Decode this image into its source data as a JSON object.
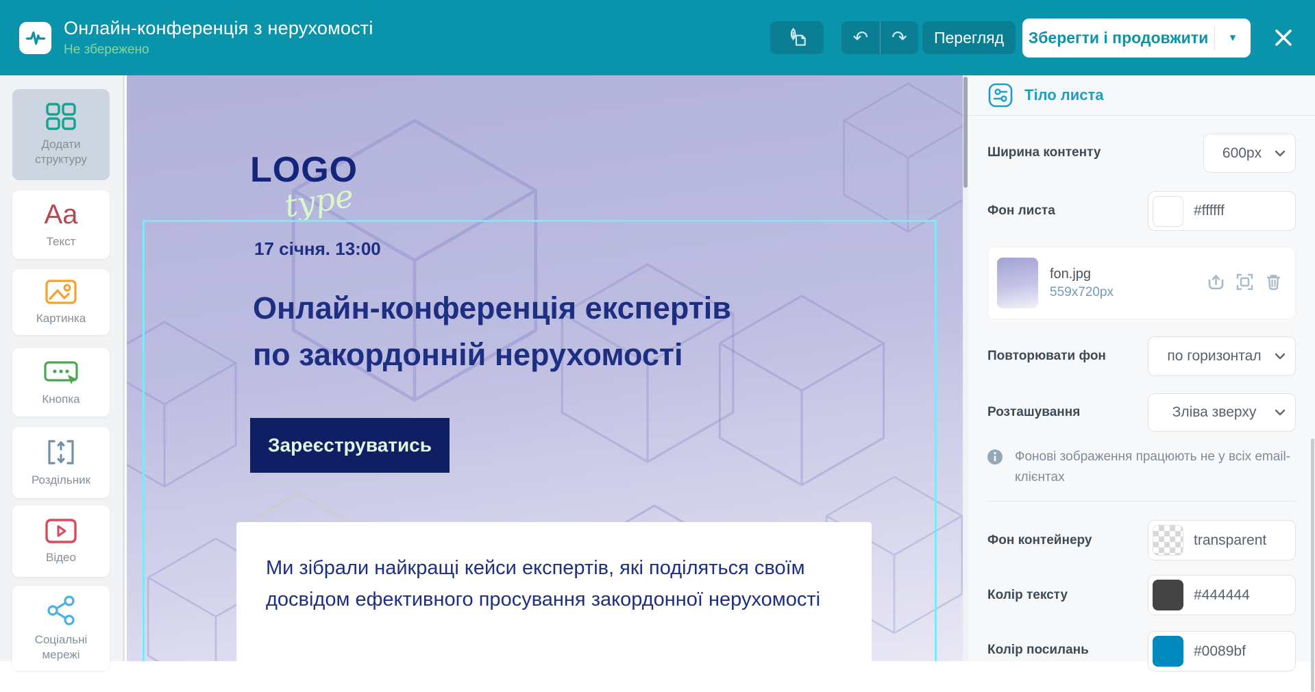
{
  "header": {
    "title": "Онлайн-конференція з нерухомості",
    "status": "Не збережено",
    "undo_glyph": "↶",
    "redo_glyph": "↷",
    "preview_label": "Перегляд",
    "save_label": "Зберегти і продовжити",
    "save_caret": "▾"
  },
  "sidebar": {
    "items": [
      {
        "label": "Додати структуру",
        "icon": "add-structure-icon",
        "selected": true
      },
      {
        "label": "Текст",
        "icon": "text-icon",
        "glyph": "Aa"
      },
      {
        "label": "Картинка",
        "icon": "image-icon"
      },
      {
        "label": "Кнопка",
        "icon": "button-icon"
      },
      {
        "label": "Роздільник",
        "icon": "divider-icon"
      },
      {
        "label": "Відео",
        "icon": "video-icon"
      },
      {
        "label": "Соціальні мережі",
        "icon": "social-icon"
      }
    ]
  },
  "canvas": {
    "logo_main": "LOGO",
    "logo_script": "type",
    "date": "17 січня. 13:00",
    "heading_line1": "Онлайн-конференція експертів",
    "heading_line2": "по закордонній нерухомості",
    "register_button": "Зареєструватись",
    "body_text": "Ми зібрали найкращі кейси експертів, які поділяться своїм досвідом ефективного просування закордонної нерухомості"
  },
  "panel": {
    "title": "Тіло листа",
    "content_width": {
      "label": "Ширина контенту",
      "value": "600px"
    },
    "letter_bg": {
      "label": "Фон листа",
      "value": "#ffffff"
    },
    "bg_file": {
      "name": "fon.jpg",
      "dimensions": "559x720px"
    },
    "repeat_bg": {
      "label": "Повторювати фон",
      "value": "по горизонтал"
    },
    "position": {
      "label": "Розташування",
      "value": "Зліва зверху"
    },
    "info_text": "Фонові зображення працюють не у всіх email-клієнтах",
    "container_bg": {
      "label": "Фон контейнеру",
      "value": "transparent"
    },
    "text_color": {
      "label": "Колір тексту",
      "value": "#444444"
    },
    "link_color": {
      "label": "Колір посилань",
      "value": "#0089bf"
    }
  },
  "colors": {
    "header_teal": "#0a94ab",
    "selection_cyan": "#7de8f8",
    "email_navy": "#1d2f82",
    "email_button_bg": "#101f63",
    "text_swatch": "#444444",
    "link_swatch": "#0089bf"
  }
}
